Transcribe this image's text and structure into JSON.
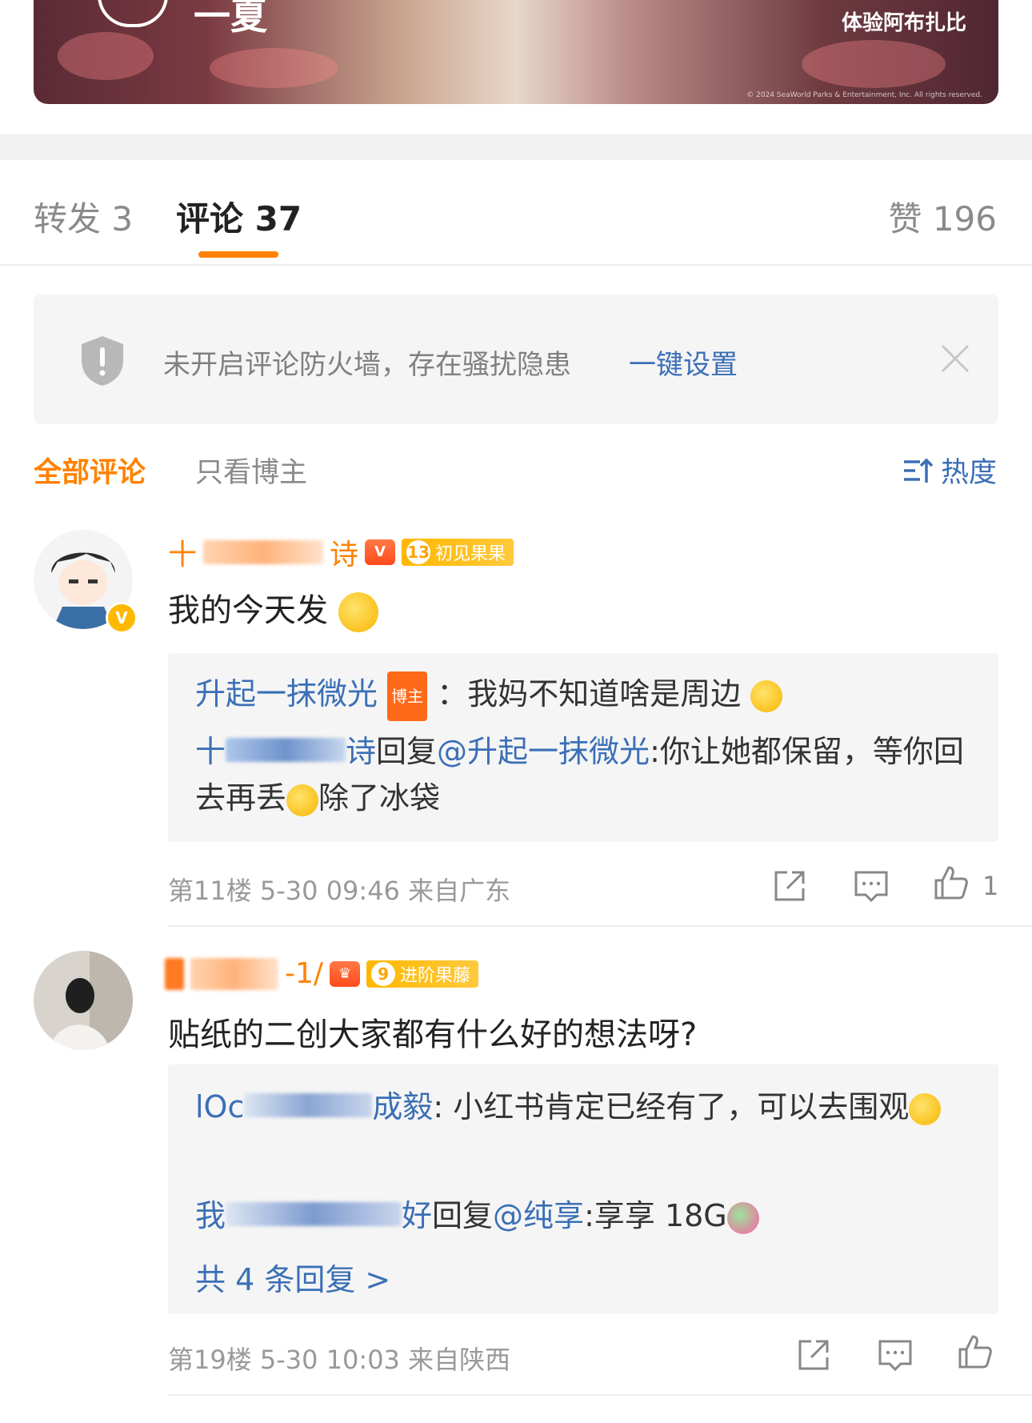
{
  "banner": {
    "title": "一夏",
    "right_text": "体验阿布扎比",
    "copyright": "© 2024 SeaWorld Parks & Entertainment, Inc. All rights reserved."
  },
  "tabs": {
    "forward": "转发 3",
    "comment": "评论 37",
    "like": "赞 196"
  },
  "notice": {
    "text": "未开启评论防火墙，存在骚扰隐患",
    "link": "一键设置"
  },
  "filters": {
    "all": "全部评论",
    "host_only": "只看博主",
    "sort": "热度"
  },
  "comments": [
    {
      "name_start": "十",
      "name_end": "诗",
      "level_num": "13",
      "level_label": "初见果果",
      "text": "我的今天发",
      "replies": [
        {
          "name": "升起一抹微光",
          "tag": "博主",
          "text": "：我妈不知道啥是周边"
        },
        {
          "name_start": "十",
          "name_end": "诗",
          "reply_word": "回复",
          "mention": "@升起一抹微光",
          "text": ":你让她都保留，等你回去再丢",
          "tail": "除了冰袋"
        }
      ],
      "meta": "第11楼 5-30 09:46 来自广东",
      "likes": "1"
    },
    {
      "name_end": "-1/",
      "level_num": "9",
      "level_label": "进阶果藤",
      "text": "贴纸的二创大家都有什么好的想法呀?",
      "replies": [
        {
          "name_start": "lOc",
          "name_end": "成毅",
          "text": ": 小红书肯定已经有了，可以去围观"
        },
        {
          "name_start": "我",
          "name_end": "好",
          "reply_word": "回复",
          "mention": "@纯享",
          "text": ":享享 18G"
        }
      ],
      "more": "共 4 条回复 >",
      "meta": "第19楼 5-30 10:03 来自陕西"
    }
  ],
  "colors": {
    "accent": "#ff8200",
    "link": "#3b6fb6",
    "muted": "#8a8a8a"
  }
}
